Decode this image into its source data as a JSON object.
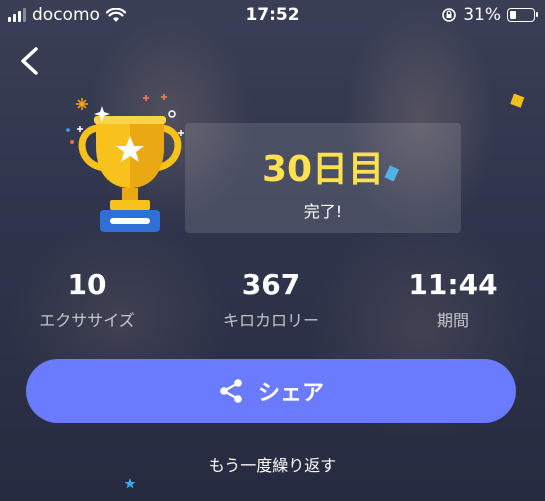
{
  "status_bar": {
    "carrier": "docomo",
    "time": "17:52",
    "battery_percent": "31%",
    "battery_level": 0.31
  },
  "card": {
    "title": "30日目",
    "subtitle": "完了!"
  },
  "stats": [
    {
      "value": "10",
      "label": "エクササイズ"
    },
    {
      "value": "367",
      "label": "キロカロリー"
    },
    {
      "value": "11:44",
      "label": "期間"
    }
  ],
  "share_button": {
    "label": "シェア",
    "icon": "share-icon"
  },
  "retry_link": "もう一度繰り返す",
  "icons": [
    "back-icon",
    "trophy-icon",
    "share-icon",
    "wifi-icon",
    "battery-icon",
    "signal-icon",
    "orientation-lock-icon"
  ],
  "colors": {
    "accent": "#6b7bff",
    "title_yellow": "#ffe14d",
    "trophy_gold": "#f7c21c"
  }
}
